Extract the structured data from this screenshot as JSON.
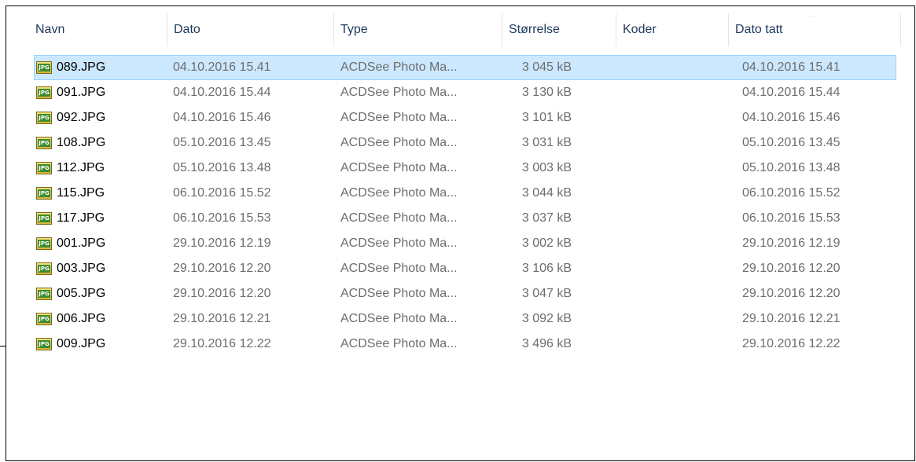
{
  "columns": [
    {
      "key": "name",
      "label": "Navn"
    },
    {
      "key": "date",
      "label": "Dato"
    },
    {
      "key": "type",
      "label": "Type"
    },
    {
      "key": "size",
      "label": "Størrelse"
    },
    {
      "key": "tags",
      "label": "Koder"
    },
    {
      "key": "date_taken",
      "label": "Dato tatt"
    }
  ],
  "icon": {
    "name": "jpg-file-icon",
    "text": "JPG"
  },
  "selected_index": 0,
  "rows": [
    {
      "name": "089.JPG",
      "date": "04.10.2016 15.41",
      "type": "ACDSee Photo Ma...",
      "size": "3 045 kB",
      "tags": "",
      "date_taken": "04.10.2016 15.41"
    },
    {
      "name": "091.JPG",
      "date": "04.10.2016 15.44",
      "type": "ACDSee Photo Ma...",
      "size": "3 130 kB",
      "tags": "",
      "date_taken": "04.10.2016 15.44"
    },
    {
      "name": "092.JPG",
      "date": "04.10.2016 15.46",
      "type": "ACDSee Photo Ma...",
      "size": "3 101 kB",
      "tags": "",
      "date_taken": "04.10.2016 15.46"
    },
    {
      "name": "108.JPG",
      "date": "05.10.2016 13.45",
      "type": "ACDSee Photo Ma...",
      "size": "3 031 kB",
      "tags": "",
      "date_taken": "05.10.2016 13.45"
    },
    {
      "name": "112.JPG",
      "date": "05.10.2016 13.48",
      "type": "ACDSee Photo Ma...",
      "size": "3 003 kB",
      "tags": "",
      "date_taken": "05.10.2016 13.48"
    },
    {
      "name": "115.JPG",
      "date": "06.10.2016 15.52",
      "type": "ACDSee Photo Ma...",
      "size": "3 044 kB",
      "tags": "",
      "date_taken": "06.10.2016 15.52"
    },
    {
      "name": "117.JPG",
      "date": "06.10.2016 15.53",
      "type": "ACDSee Photo Ma...",
      "size": "3 037 kB",
      "tags": "",
      "date_taken": "06.10.2016 15.53"
    },
    {
      "name": "001.JPG",
      "date": "29.10.2016 12.19",
      "type": "ACDSee Photo Ma...",
      "size": "3 002 kB",
      "tags": "",
      "date_taken": "29.10.2016 12.19"
    },
    {
      "name": "003.JPG",
      "date": "29.10.2016 12.20",
      "type": "ACDSee Photo Ma...",
      "size": "3 106 kB",
      "tags": "",
      "date_taken": "29.10.2016 12.20"
    },
    {
      "name": "005.JPG",
      "date": "29.10.2016 12.20",
      "type": "ACDSee Photo Ma...",
      "size": "3 047 kB",
      "tags": "",
      "date_taken": "29.10.2016 12.20"
    },
    {
      "name": "006.JPG",
      "date": "29.10.2016 12.21",
      "type": "ACDSee Photo Ma...",
      "size": "3 092 kB",
      "tags": "",
      "date_taken": "29.10.2016 12.21"
    },
    {
      "name": "009.JPG",
      "date": "29.10.2016 12.22",
      "type": "ACDSee Photo Ma...",
      "size": "3 496 kB",
      "tags": "",
      "date_taken": "29.10.2016 12.22"
    }
  ]
}
